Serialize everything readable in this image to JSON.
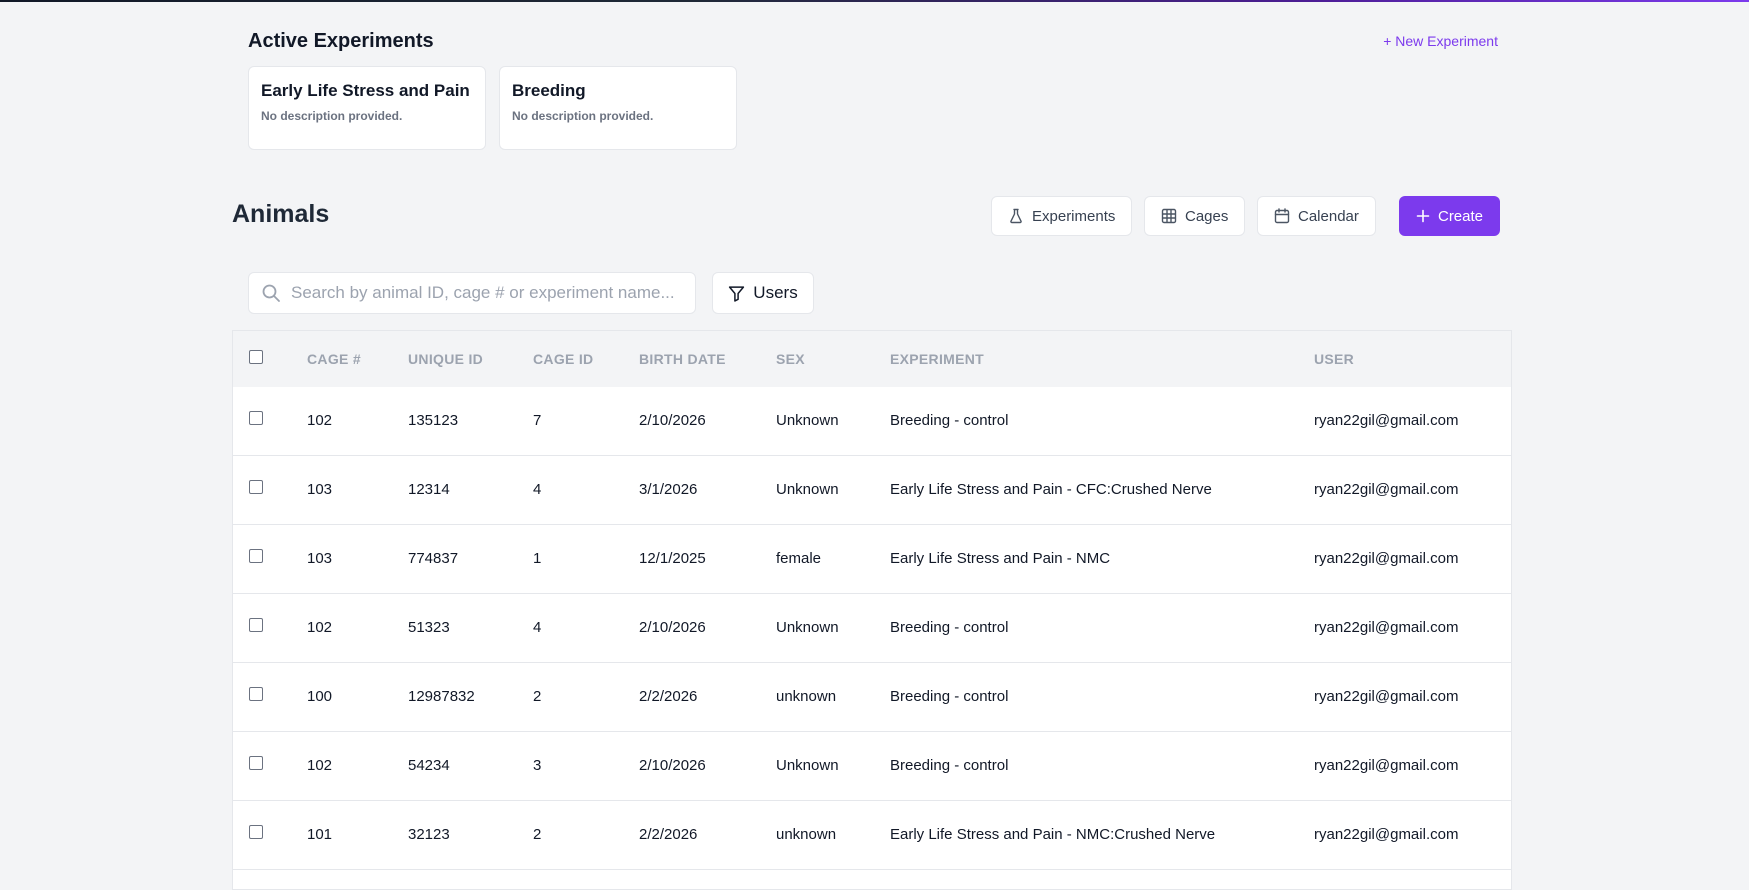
{
  "active_experiments": {
    "title": "Active Experiments",
    "new_label": "+ New Experiment",
    "cards": [
      {
        "title": "Early Life Stress and Pain",
        "description": "No description provided."
      },
      {
        "title": "Breeding",
        "description": "No description provided."
      }
    ]
  },
  "animals": {
    "title": "Animals",
    "nav": {
      "experiments": "Experiments",
      "cages": "Cages",
      "calendar": "Calendar"
    },
    "create_label": "Create",
    "search_placeholder": "Search by animal ID, cage # or experiment name...",
    "filter_label": "Users",
    "columns": [
      "CAGE #",
      "UNIQUE ID",
      "CAGE ID",
      "BIRTH DATE",
      "SEX",
      "EXPERIMENT",
      "USER"
    ],
    "rows": [
      [
        "102",
        "135123",
        "7",
        "2/10/2026",
        "Unknown",
        "Breeding - control",
        "ryan22gil@gmail.com"
      ],
      [
        "103",
        "12314",
        "4",
        "3/1/2026",
        "Unknown",
        "Early Life Stress and Pain - CFC:Crushed Nerve",
        "ryan22gil@gmail.com"
      ],
      [
        "103",
        "774837",
        "1",
        "12/1/2025",
        "female",
        "Early Life Stress and Pain - NMC",
        "ryan22gil@gmail.com"
      ],
      [
        "102",
        "51323",
        "4",
        "2/10/2026",
        "Unknown",
        "Breeding - control",
        "ryan22gil@gmail.com"
      ],
      [
        "100",
        "12987832",
        "2",
        "2/2/2026",
        "unknown",
        "Breeding - control",
        "ryan22gil@gmail.com"
      ],
      [
        "102",
        "54234",
        "3",
        "2/10/2026",
        "Unknown",
        "Breeding - control",
        "ryan22gil@gmail.com"
      ],
      [
        "101",
        "32123",
        "2",
        "2/2/2026",
        "unknown",
        "Early Life Stress and Pain - NMC:Crushed Nerve",
        "ryan22gil@gmail.com"
      ]
    ]
  },
  "colors": {
    "accent": "#7c3aed",
    "background": "#f3f4f6",
    "border": "#e5e7eb"
  },
  "icons": {
    "experiments": "flask-icon",
    "cages": "grid-icon",
    "calendar": "calendar-icon",
    "create": "plus-icon",
    "search": "search-icon",
    "filter": "filter-icon"
  }
}
